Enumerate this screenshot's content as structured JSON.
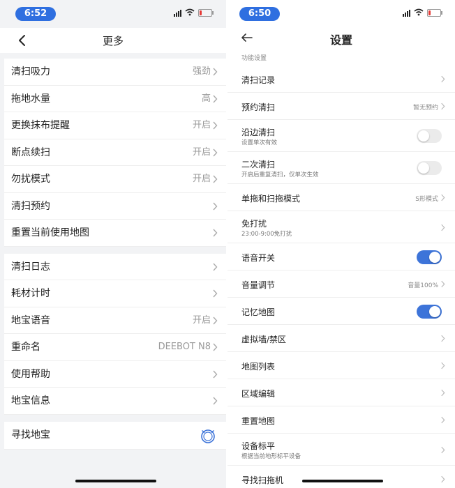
{
  "left": {
    "time": "6:52",
    "title": "更多",
    "groups": [
      [
        {
          "label": "清扫吸力",
          "value": "强劲"
        },
        {
          "label": "拖地水量",
          "value": "高"
        },
        {
          "label": "更换抹布提醒",
          "value": "开启"
        },
        {
          "label": "断点续扫",
          "value": "开启"
        },
        {
          "label": "勿扰模式",
          "value": "开启"
        },
        {
          "label": "清扫预约",
          "value": ""
        },
        {
          "label": "重置当前使用地图",
          "value": ""
        }
      ],
      [
        {
          "label": "清扫日志",
          "value": ""
        },
        {
          "label": "耗材计时",
          "value": ""
        },
        {
          "label": "地宝语音",
          "value": "开启"
        },
        {
          "label": "重命名",
          "value": "DEEBOT N8"
        },
        {
          "label": "使用帮助",
          "value": ""
        },
        {
          "label": "地宝信息",
          "value": ""
        }
      ]
    ],
    "find": {
      "label": "寻找地宝",
      "icon": "robot-icon"
    }
  },
  "right": {
    "time": "6:50",
    "title": "设置",
    "section": "功能设置",
    "items": [
      {
        "label": "清扫记录",
        "type": "chevron"
      },
      {
        "label": "预约清扫",
        "type": "chevron",
        "value": "暂无预约"
      },
      {
        "label": "沿边清扫",
        "sub": "设置单次有效",
        "type": "toggle",
        "on": false
      },
      {
        "label": "二次清扫",
        "sub": "开启后重复清扫，仅单次生效",
        "type": "toggle",
        "on": false
      },
      {
        "label": "单拖和扫拖模式",
        "type": "chevron",
        "value": "S形模式"
      },
      {
        "label": "免打扰",
        "sub": "23:00-9:00免打扰",
        "type": "chevron"
      },
      {
        "label": "语音开关",
        "type": "toggle",
        "on": true
      },
      {
        "label": "音量调节",
        "type": "chevron",
        "value": "音量100%"
      },
      {
        "label": "记忆地图",
        "type": "toggle",
        "on": true
      },
      {
        "label": "虚拟墙/禁区",
        "type": "chevron"
      },
      {
        "label": "地图列表",
        "type": "chevron"
      },
      {
        "label": "区域编辑",
        "type": "chevron"
      },
      {
        "label": "重置地图",
        "type": "chevron"
      },
      {
        "label": "设备标平",
        "sub": "根据当前地形标平设备",
        "type": "chevron"
      },
      {
        "label": "寻找扫拖机",
        "type": "chevron"
      }
    ]
  },
  "colors": {
    "accent": "#3d74d9",
    "time_pill": "#2f6fe0",
    "group_bg": "#f2f3f5",
    "battery_low": "#e53935"
  }
}
